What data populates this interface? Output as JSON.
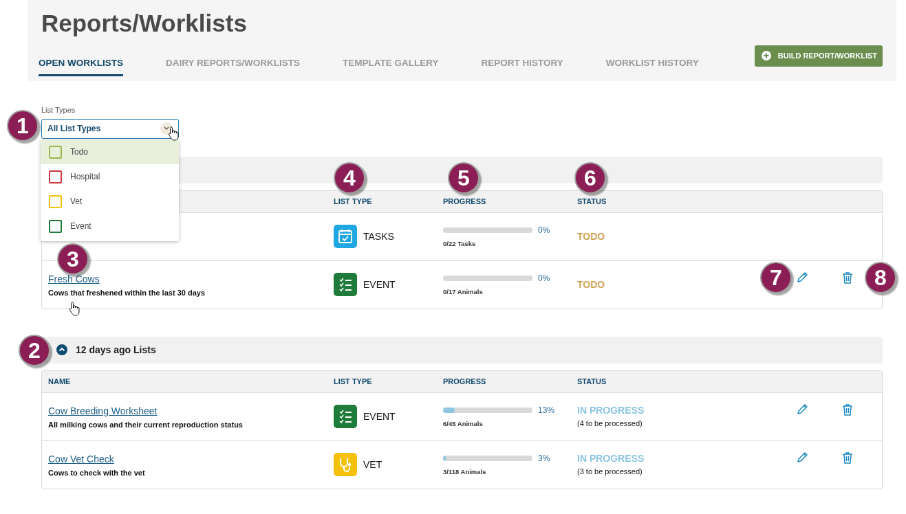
{
  "page_title": "Reports/Worklists",
  "tabs": [
    {
      "label": "OPEN WORKLISTS",
      "selected": true
    },
    {
      "label": "DAIRY REPORTS/WORKLISTS",
      "selected": false
    },
    {
      "label": "TEMPLATE GALLERY",
      "selected": false
    },
    {
      "label": "REPORT HISTORY",
      "selected": false
    },
    {
      "label": "WORKLIST HISTORY",
      "selected": false
    }
  ],
  "build_button": {
    "label": "BUILD REPORT/WORKLIST"
  },
  "filter": {
    "label": "List Types",
    "value": "All List Types",
    "expanded": true,
    "options": [
      {
        "label": "Todo",
        "color": "#9ab84a",
        "selected": true
      },
      {
        "label": "Hospital",
        "color": "#c8383d",
        "selected": false
      },
      {
        "label": "Vet",
        "color": "#f4c20d",
        "selected": false
      },
      {
        "label": "Event",
        "color": "#1e7b3a",
        "selected": false
      }
    ]
  },
  "groups": [
    {
      "columns": [
        "LIST TYPE",
        "PROGRESS",
        "STATUS"
      ],
      "rows": [
        {
          "type": {
            "kind": "tasks",
            "label": "TASKS"
          },
          "level": 0,
          "percent": "0%",
          "count": "0/22 Tasks",
          "status": {
            "kind": "todo",
            "label": "TODO"
          },
          "actions": false
        },
        {
          "name": "Fresh Cows",
          "description": "Cows that freshened within the last 30 days",
          "type": {
            "kind": "event",
            "label": "EVENT"
          },
          "level": 0,
          "percent": "0%",
          "count": "0/17 Animals",
          "status": {
            "kind": "todo",
            "label": "TODO"
          },
          "actions": true
        }
      ]
    },
    {
      "label": "12 days ago Lists",
      "expanded": true,
      "columns": [
        "NAME",
        "LIST TYPE",
        "PROGRESS",
        "STATUS"
      ],
      "rows": [
        {
          "name": "Cow Breeding Worksheet",
          "description": "All milking cows and their current reproduction status",
          "type": {
            "kind": "event",
            "label": "EVENT"
          },
          "level": 0.13,
          "percent": "13%",
          "count": "6/45 Animals",
          "status": {
            "kind": "in_progress",
            "label": "IN PROGRESS",
            "note": "(4 to be processed)"
          },
          "actions": true
        },
        {
          "name": "Cow Vet Check",
          "description": "Cows to check with the vet",
          "type": {
            "kind": "vet",
            "label": "VET"
          },
          "level": 0.03,
          "percent": "3%",
          "count": "3/118 Animals",
          "status": {
            "kind": "in_progress",
            "label": "IN PROGRESS",
            "note": "(3 to be processed)"
          },
          "actions": true
        }
      ]
    }
  ],
  "callouts": [
    "1",
    "2",
    "3",
    "4",
    "5",
    "6",
    "7",
    "8"
  ]
}
